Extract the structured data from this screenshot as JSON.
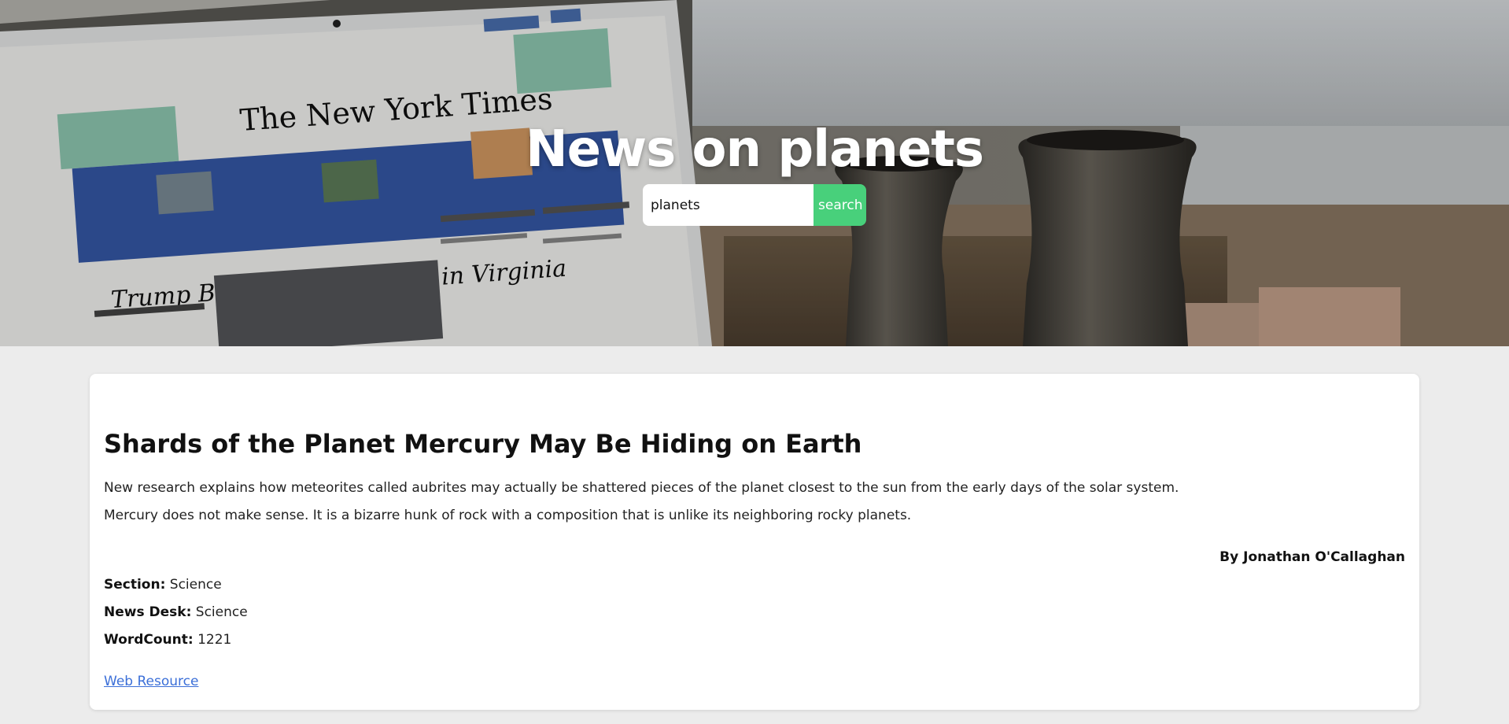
{
  "hero": {
    "title": "News on planets",
    "search_value": "planets",
    "search_button_label": "search",
    "background_image": "laptop-newspaper-and-pottery-photo"
  },
  "article": {
    "title": "Shards of the Planet Mercury May Be Hiding on Earth",
    "abstract": "New research explains how meteorites called aubrites may actually be shattered pieces of the planet closest to the sun from the early days of the solar system.",
    "lead_paragraph": "Mercury does not make sense. It is a bizarre hunk of rock with a composition that is unlike its neighboring rocky planets.",
    "byline": "By Jonathan O'Callaghan",
    "section_label": "Section:",
    "section_value": "Science",
    "news_desk_label": "News Desk:",
    "news_desk_value": "Science",
    "word_count_label": "WordCount:",
    "word_count_value": "1221",
    "link_label": "Web Resource"
  },
  "colors": {
    "accent_green": "#48d07b",
    "link_blue": "#3b6fd8",
    "page_bg": "#ececec"
  }
}
